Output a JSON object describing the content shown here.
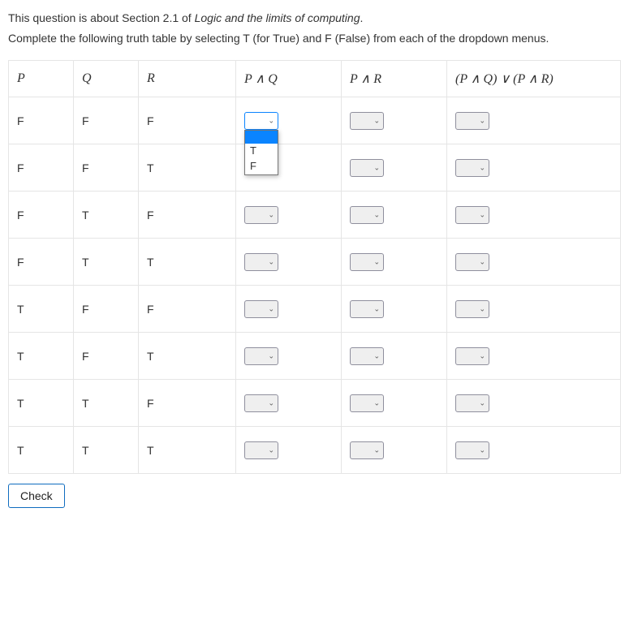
{
  "intro": {
    "line1_pre": "This question is about Section 2.1 of ",
    "line1_em": "Logic and the limits of computing",
    "line1_post": ".",
    "line2": "Complete the following truth table by selecting T (for True) and F (False) from each of the dropdown menus."
  },
  "headers": {
    "p": "P",
    "q": "Q",
    "r": "R",
    "pq": "P ∧ Q",
    "pr": "P ∧ R",
    "result": "(P ∧ Q) ∨ (P ∧ R)"
  },
  "rows": [
    {
      "p": "F",
      "q": "F",
      "r": "F"
    },
    {
      "p": "F",
      "q": "F",
      "r": "T"
    },
    {
      "p": "F",
      "q": "T",
      "r": "F"
    },
    {
      "p": "F",
      "q": "T",
      "r": "T"
    },
    {
      "p": "T",
      "q": "F",
      "r": "F"
    },
    {
      "p": "T",
      "q": "F",
      "r": "T"
    },
    {
      "p": "T",
      "q": "T",
      "r": "F"
    },
    {
      "p": "T",
      "q": "T",
      "r": "T"
    }
  ],
  "dropdown": {
    "options": {
      "blank": "",
      "t": "T",
      "f": "F"
    },
    "open_row": 0,
    "open_col": "pq"
  },
  "buttons": {
    "check": "Check"
  }
}
